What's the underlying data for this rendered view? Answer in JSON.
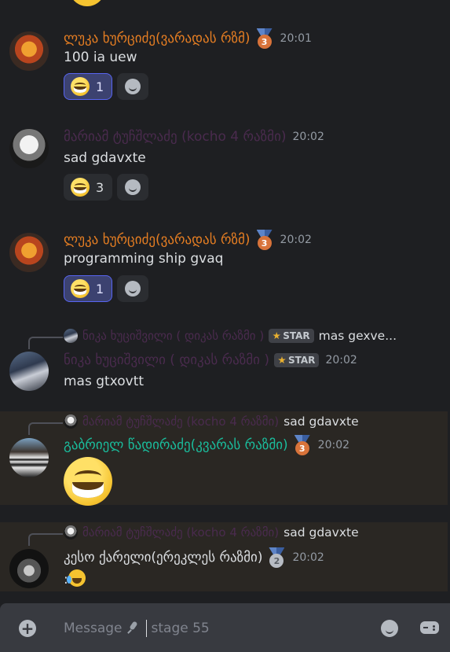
{
  "colors": {
    "background": "#1e1f22",
    "mention_highlight": "#2a2723",
    "name_orange": "#e67e22",
    "name_purple": "#4a2b4e",
    "name_teal": "#1abc9c",
    "name_white": "#dbdee1",
    "reaction_active": "#3c4270"
  },
  "messages": [
    {
      "author": "ლუკა ხურციძე(ვარადას რზმ)",
      "medal": "3",
      "time": "20:01",
      "text": "100 ia uew",
      "reactions": [
        {
          "emoji": "laughing-emoji",
          "count": "1",
          "active": true
        }
      ]
    },
    {
      "author": "მარიამ ტუჩშლაძე (kocho 4 რაზმი)",
      "time": "20:02",
      "text": "sad gdavxte",
      "reactions": [
        {
          "emoji": "laughing-emoji",
          "count": "3",
          "active": false
        }
      ]
    },
    {
      "author": "ლუკა ხურციძე(ვარადას რზმ)",
      "medal": "3",
      "time": "20:02",
      "text": "programming ship gvaq",
      "reactions": [
        {
          "emoji": "laughing-emoji",
          "count": "1",
          "active": true
        }
      ]
    },
    {
      "reply_author": "ნიკა ხუციშვილი ( დიკას რაზმი )",
      "reply_tag": "STAR",
      "reply_text": "mas gexve...",
      "author": "ნიკა ხუციშვილი ( დიკას რაზმი )",
      "tag": "STAR",
      "time": "20:02",
      "text": "mas gtxovtt"
    },
    {
      "reply_author": "მარიამ ტუჩშლაძე (kocho 4 რაზმი)",
      "reply_text": "sad gdavxte",
      "author": "გაბრიელ წადირაძე(კვარას რაზმი)",
      "medal": "3",
      "time": "20:02",
      "text": "laughing-emoji"
    },
    {
      "reply_author": "მარიამ ტუჩშლაძე (kocho 4 რაზმი)",
      "reply_text": "sad gdavxte",
      "author": "კესო ქარელი(ერეკლეს რაზმი)",
      "medal": "2",
      "time": "20:02",
      "text": ":"
    }
  ],
  "composer": {
    "placeholder": "Message",
    "suffix": "stage 55"
  }
}
